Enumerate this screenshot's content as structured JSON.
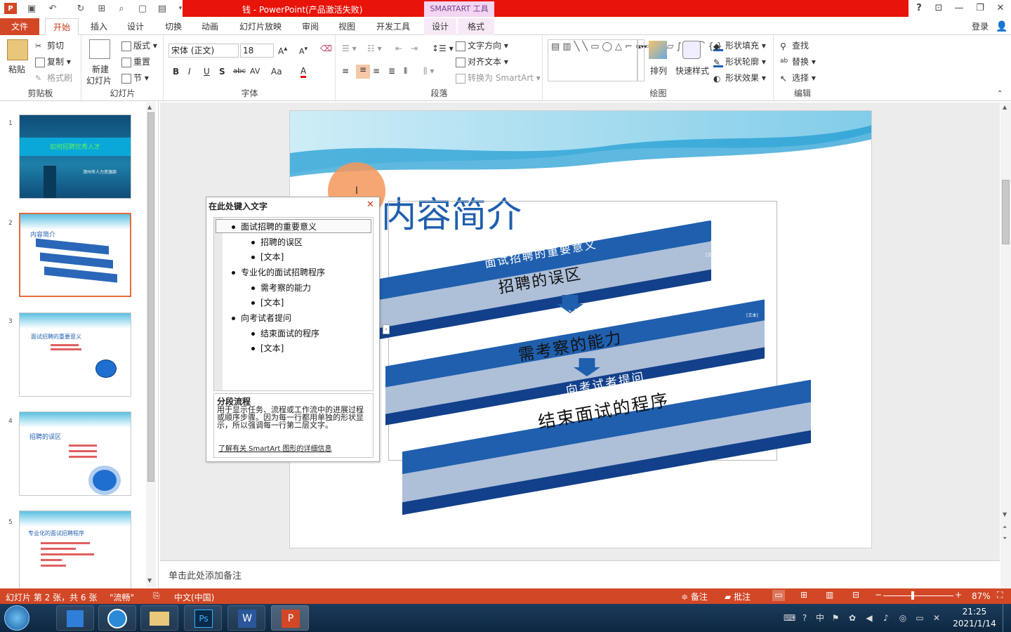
{
  "window": {
    "title": "钱 - PowerPoint(产品激活失败)",
    "contextual_tab": "SMARTART 工具",
    "help": "?",
    "login": "登录"
  },
  "tabs": [
    {
      "label": "文件"
    },
    {
      "label": "开始"
    },
    {
      "label": "插入"
    },
    {
      "label": "设计"
    },
    {
      "label": "切换"
    },
    {
      "label": "动画"
    },
    {
      "label": "幻灯片放映"
    },
    {
      "label": "审阅"
    },
    {
      "label": "视图"
    },
    {
      "label": "开发工具"
    },
    {
      "label": "设计"
    },
    {
      "label": "格式"
    }
  ],
  "ribbon": {
    "clipboard": {
      "label": "剪贴板",
      "paste": "粘贴",
      "cut": "剪切",
      "copy": "复制",
      "format_painter": "格式刷"
    },
    "slides": {
      "label": "幻灯片",
      "new_slide_1": "新建",
      "new_slide_2": "幻灯片",
      "layout": "版式",
      "reset": "重置",
      "section": "节"
    },
    "font": {
      "label": "字体",
      "font_name": "宋体 (正文)",
      "font_size": "18",
      "bold": "B",
      "italic": "I",
      "underline": "U",
      "shadow": "S",
      "strike": "abc",
      "spacing": "AV",
      "case": "Aa",
      "color": "A"
    },
    "paragraph": {
      "label": "段落",
      "text_direction": "文字方向",
      "align_text": "对齐文本",
      "convert_smartart": "转换为 SmartArt"
    },
    "drawing": {
      "label": "绘图",
      "arrange": "排列",
      "quick_styles": "快速样式",
      "shape_fill": "形状填充",
      "shape_outline": "形状轮廓",
      "shape_effects": "形状效果"
    },
    "editing": {
      "label": "编辑",
      "find": "查找",
      "replace": "替换",
      "select": "选择"
    }
  },
  "thumbnails": [
    {
      "num": "1",
      "title": "如何招聘优秀人才",
      "subtitle": "漳州市人力资源部"
    },
    {
      "num": "2",
      "title": "内容简介"
    },
    {
      "num": "3",
      "title": "面试招聘的重要意义"
    },
    {
      "num": "4",
      "title": "招聘的误区"
    },
    {
      "num": "5",
      "title": "专业化的面试招聘程序"
    }
  ],
  "slide": {
    "title": "内容简介",
    "smartart": [
      {
        "header": "面试招聘的重要意义",
        "body": "招聘的误区",
        "tag": "[文本]"
      },
      {
        "header": "专业化的面试招聘程序",
        "body": "需考察的能力",
        "tag": "[文本]"
      },
      {
        "header": "向考试者提问",
        "body": "结束面试的程序",
        "tag": "[文本]"
      }
    ]
  },
  "text_pane": {
    "title": "在此处键入文字",
    "items": [
      {
        "text": "面试招聘的重要意义",
        "level": 1
      },
      {
        "text": "招聘的误区",
        "level": 2
      },
      {
        "text": "[文本]",
        "level": 2
      },
      {
        "text": "专业化的面试招聘程序",
        "level": 1
      },
      {
        "text": "需考察的能力",
        "level": 2
      },
      {
        "text": "[文本]",
        "level": 2
      },
      {
        "text": "向考试者提问",
        "level": 1
      },
      {
        "text": "结束面试的程序",
        "level": 2
      },
      {
        "text": "[文本]",
        "level": 2
      }
    ],
    "desc_title": "分段流程",
    "desc_body": "用于显示任务、流程或工作流中的进展过程或顺序步骤。因为每一行都用单独的形状显示，所以强调每一行第二层文字。",
    "link": "了解有关 SmartArt 图形的详细信息"
  },
  "notes": {
    "placeholder": "单击此处添加备注"
  },
  "status": {
    "slide_info": "幻灯片 第 2 张，共 6 张",
    "theme": "\"流畅\"",
    "language": "中文(中国)",
    "notes": "备注",
    "comments": "批注",
    "zoom": "87%"
  },
  "taskbar": {
    "time": "21:25",
    "date": "2021/1/14"
  },
  "colors": {
    "accent": "#d24726",
    "title_red": "#e8140a",
    "smartart_blue": "#1f5fae"
  }
}
